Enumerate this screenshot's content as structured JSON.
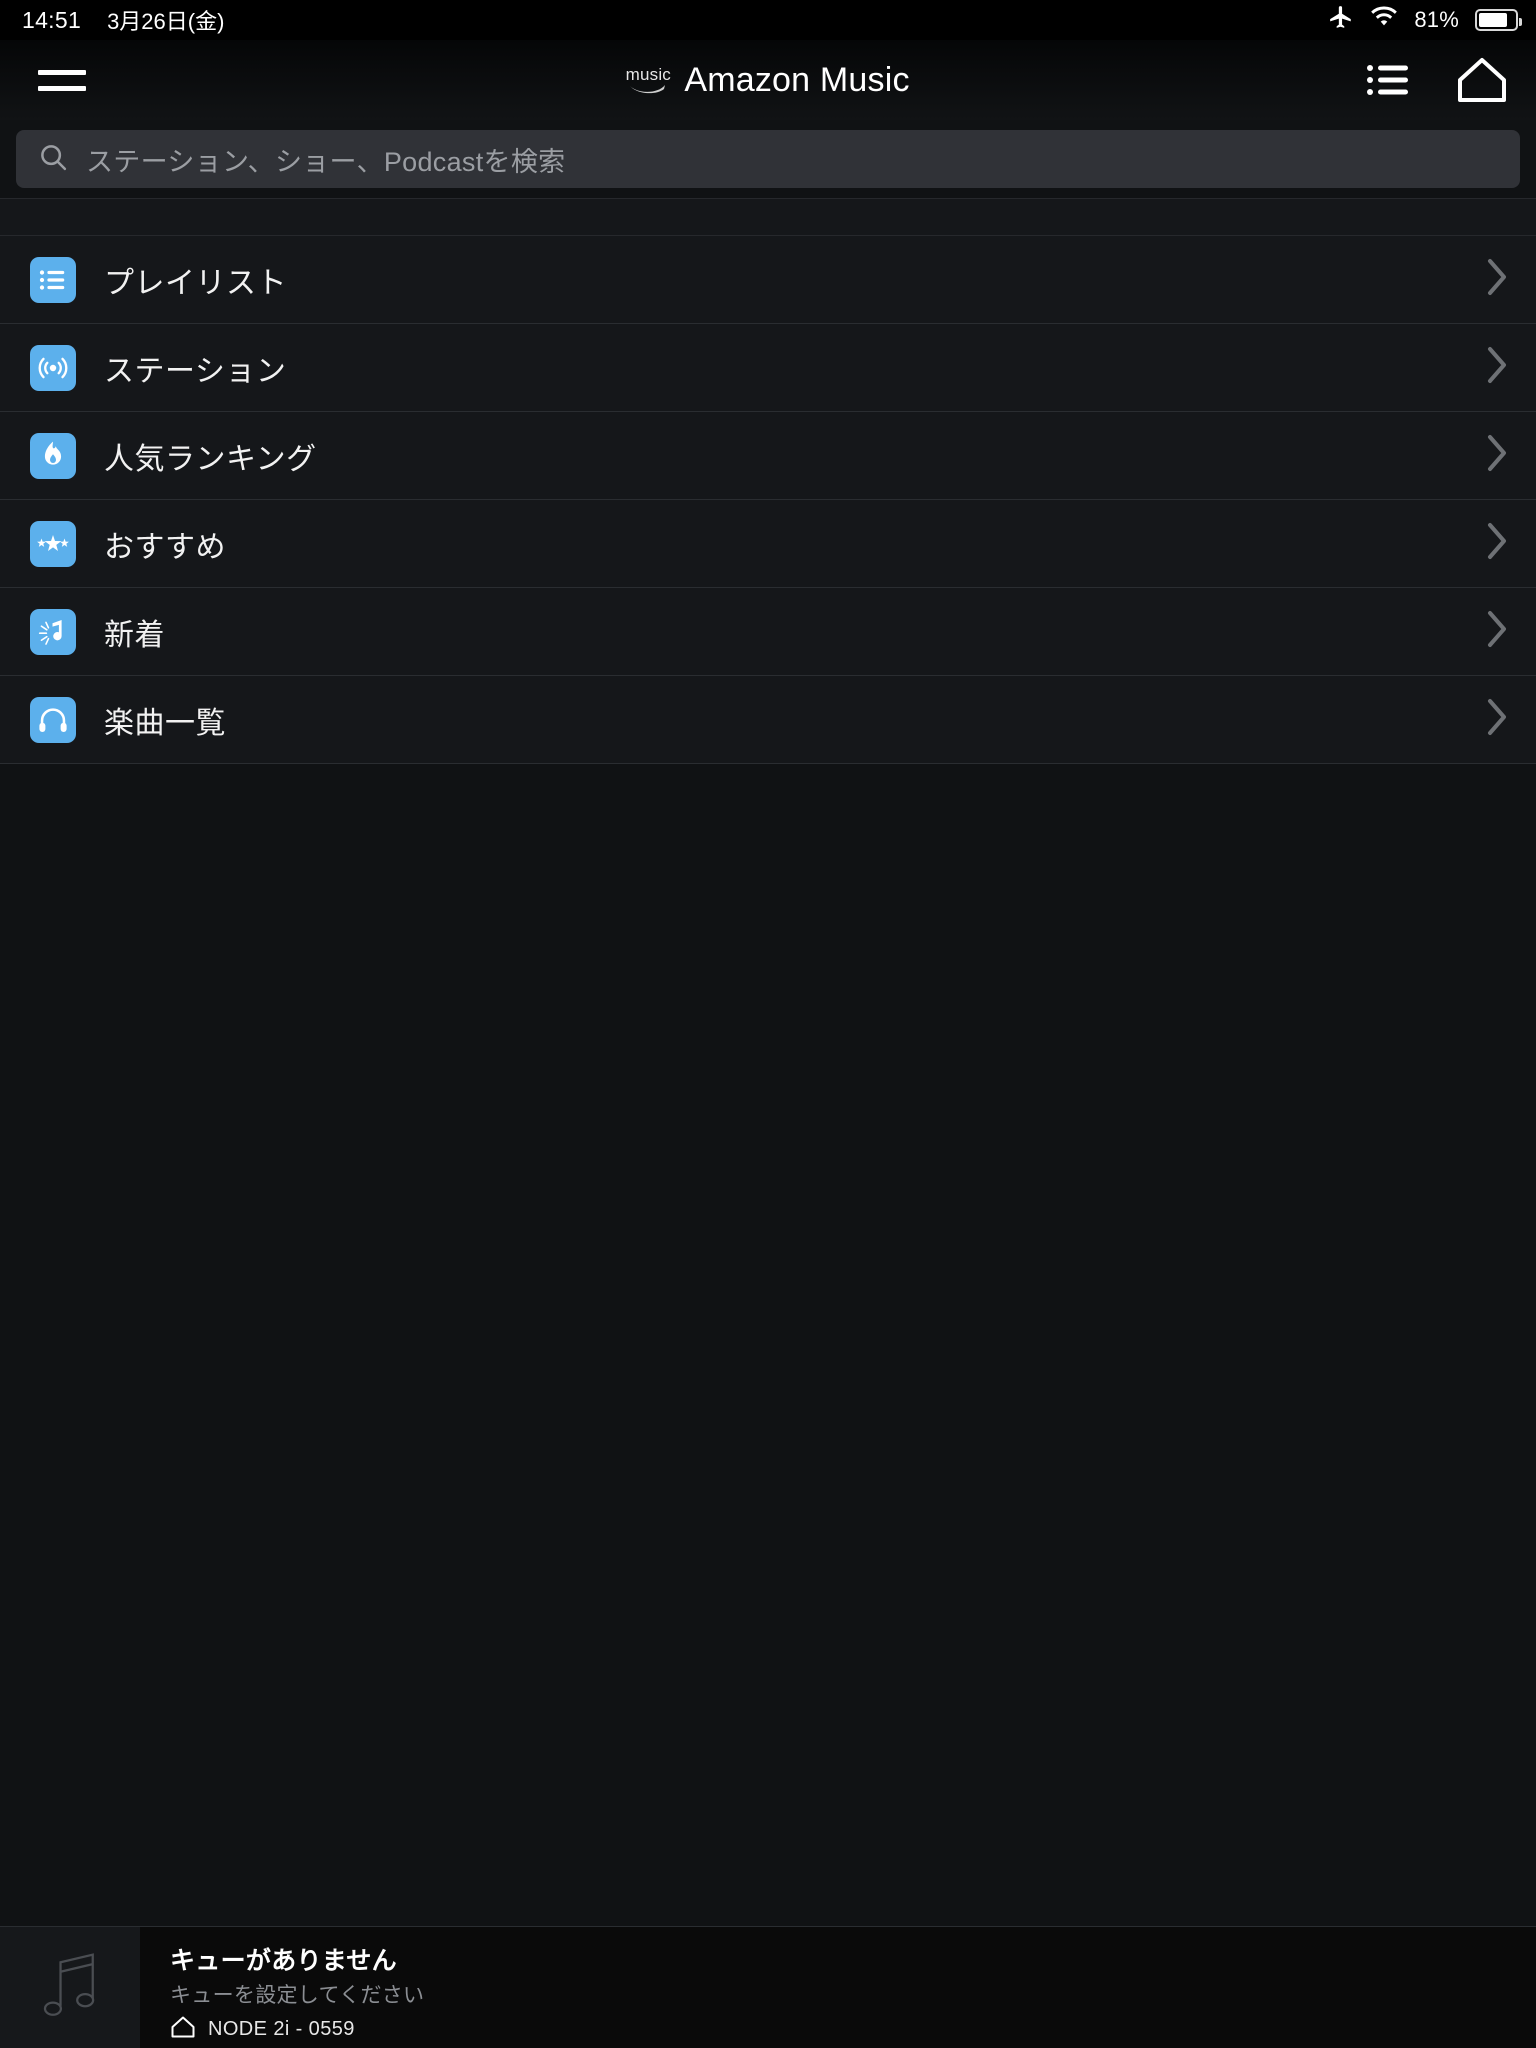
{
  "status_bar": {
    "time": "14:51",
    "date": "3月26日(金)",
    "airplane_icon": "airplane-icon",
    "wifi_icon": "wifi-icon",
    "battery_percent": "81%",
    "battery_level": 81
  },
  "header": {
    "menu_icon": "hamburger-menu-icon",
    "logo_word": "music",
    "title": "Amazon Music",
    "queue_icon": "queue-list-icon",
    "home_icon": "home-icon"
  },
  "search": {
    "icon": "search-icon",
    "placeholder": "ステーション、ショー、Podcastを検索",
    "value": ""
  },
  "menu": {
    "items": [
      {
        "label": "プレイリスト",
        "icon": "playlist-icon",
        "chevron": "chevron-right-icon"
      },
      {
        "label": "ステーション",
        "icon": "radio-waves-icon",
        "chevron": "chevron-right-icon"
      },
      {
        "label": "人気ランキング",
        "icon": "flame-icon",
        "chevron": "chevron-right-icon"
      },
      {
        "label": "おすすめ",
        "icon": "stars-icon",
        "chevron": "chevron-right-icon"
      },
      {
        "label": "新着",
        "icon": "new-music-note-icon",
        "chevron": "chevron-right-icon"
      },
      {
        "label": "楽曲一覧",
        "icon": "headphones-icon",
        "chevron": "chevron-right-icon"
      }
    ]
  },
  "player": {
    "artwork_icon": "music-note-placeholder-icon",
    "title": "キューがありません",
    "subtitle": "キューを設定してください",
    "device_icon": "home-icon",
    "device_name": "NODE 2i - 0559"
  },
  "colors": {
    "accent": "#5cb0ec",
    "background": "#101214",
    "list_background": "#15171a",
    "search_background": "#303237",
    "text_primary": "#f2f2f2",
    "text_muted": "#8b8e93"
  }
}
